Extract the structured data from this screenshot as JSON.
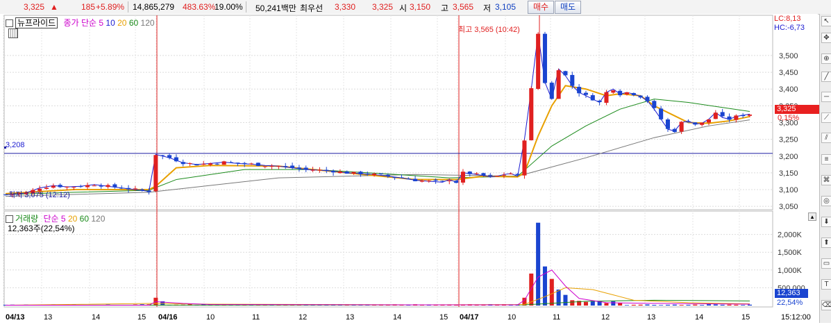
{
  "quote": {
    "price": "3,325",
    "arrow": "▲",
    "change": "185",
    "change_pct": "+5.89%",
    "volume": "14,865,279",
    "volume_ratio": "483.63%",
    "turnover": "19.00%",
    "amount": "50,241백만",
    "best_label": "최우선",
    "ask": "3,330",
    "bid": "3,325",
    "open_label": "시",
    "open": "3,150",
    "high_label": "고",
    "high": "3,565",
    "low_label": "저",
    "low": "3,105",
    "buy_button": "매수",
    "sell_button": "매도"
  },
  "price_legend": {
    "series_box": "뉴프라이드",
    "ma_label": "종가 단순",
    "ma5": "5",
    "ma10": "10",
    "ma20": "20",
    "ma60": "60",
    "ma120": "120"
  },
  "volume_legend": {
    "title": "거래량",
    "ma_label": "단순",
    "ma5": "5",
    "ma20": "20",
    "ma60": "60",
    "ma120": "120",
    "current": "12,363주(22,54%)"
  },
  "annotations": {
    "high_mark": "최고 3,565 (10:42)",
    "low_mark": "최저 3,075 (12:12)",
    "ref_price": "3,208",
    "lc": "LC:8,13",
    "hc": "HC:-6,73",
    "price_badge": "3,325",
    "price_badge_pct": "0,15%",
    "vol_badge": "12,363",
    "vol_badge_pct": "22,54%"
  },
  "colors": {
    "up": "#e02020",
    "down": "#1a44d0",
    "ma5": "#cc00cc",
    "ma10": "#1a1ad0",
    "ma20": "#e8a000",
    "ma60": "#1a8a1a",
    "ma120": "#777777"
  },
  "chart_data": {
    "type": "candlestick",
    "price_axis": {
      "range": [
        3040,
        3620
      ],
      "ticks": [
        "3,050",
        "3,100",
        "3,150",
        "3,200",
        "3,250",
        "3,300",
        "3,350",
        "3,400",
        "3,450",
        "3,500"
      ]
    },
    "volume_axis": {
      "range": [
        0,
        2500000
      ],
      "ticks": [
        "500,000",
        "1,000K",
        "1,500K",
        "2,000K"
      ]
    },
    "time_axis": [
      "04/13",
      "13",
      "14",
      "15",
      "04/16",
      "10",
      "11",
      "12",
      "13",
      "14",
      "15",
      "04/17",
      "10",
      "11",
      "12",
      "13",
      "14",
      "15",
      "15:12:00"
    ],
    "reference_line": 3208,
    "price_path": [
      [
        0,
        3085
      ],
      [
        3,
        3090
      ],
      [
        5,
        3105
      ],
      [
        7,
        3112
      ],
      [
        9,
        3108
      ],
      [
        11,
        3110
      ],
      [
        13,
        3115
      ],
      [
        15,
        3110
      ],
      [
        17,
        3105
      ],
      [
        19,
        3100
      ],
      [
        21,
        3095
      ],
      [
        22,
        3205
      ],
      [
        24,
        3195
      ],
      [
        26,
        3180
      ],
      [
        28,
        3175
      ],
      [
        30,
        3178
      ],
      [
        32,
        3182
      ],
      [
        34,
        3178
      ],
      [
        36,
        3176
      ],
      [
        38,
        3172
      ],
      [
        40,
        3170
      ],
      [
        42,
        3165
      ],
      [
        44,
        3160
      ],
      [
        46,
        3158
      ],
      [
        48,
        3155
      ],
      [
        50,
        3150
      ],
      [
        52,
        3148
      ],
      [
        54,
        3145
      ],
      [
        56,
        3140
      ],
      [
        58,
        3135
      ],
      [
        60,
        3128
      ],
      [
        62,
        3125
      ],
      [
        64,
        3122
      ],
      [
        65,
        3130
      ],
      [
        66,
        3122
      ],
      [
        67,
        3150
      ],
      [
        68,
        3148
      ],
      [
        69,
        3145
      ],
      [
        70,
        3142
      ],
      [
        71,
        3138
      ],
      [
        72,
        3140
      ],
      [
        73,
        3145
      ],
      [
        74,
        3148
      ],
      [
        75,
        3140
      ],
      [
        76,
        3250
      ],
      [
        77,
        3400
      ],
      [
        78,
        3565
      ],
      [
        79,
        3420
      ],
      [
        80,
        3370
      ],
      [
        81,
        3460
      ],
      [
        82,
        3440
      ],
      [
        83,
        3410
      ],
      [
        84,
        3390
      ],
      [
        85,
        3380
      ],
      [
        86,
        3370
      ],
      [
        87,
        3360
      ],
      [
        88,
        3390
      ],
      [
        89,
        3400
      ],
      [
        90,
        3385
      ],
      [
        91,
        3390
      ],
      [
        92,
        3385
      ],
      [
        93,
        3378
      ],
      [
        94,
        3365
      ],
      [
        95,
        3340
      ],
      [
        96,
        3310
      ],
      [
        97,
        3280
      ],
      [
        98,
        3275
      ],
      [
        99,
        3300
      ],
      [
        100,
        3305
      ],
      [
        101,
        3295
      ],
      [
        102,
        3298
      ],
      [
        103,
        3310
      ],
      [
        104,
        3330
      ],
      [
        105,
        3315
      ],
      [
        106,
        3310
      ],
      [
        107,
        3318
      ],
      [
        108,
        3322
      ],
      [
        109,
        3325
      ]
    ],
    "ma_price": {
      "ma20": [
        [
          0,
          3088
        ],
        [
          10,
          3100
        ],
        [
          21,
          3100
        ],
        [
          22,
          3110
        ],
        [
          25,
          3165
        ],
        [
          30,
          3172
        ],
        [
          40,
          3170
        ],
        [
          50,
          3150
        ],
        [
          60,
          3130
        ],
        [
          66,
          3130
        ],
        [
          70,
          3140
        ],
        [
          75,
          3138
        ],
        [
          76,
          3150
        ],
        [
          78,
          3260
        ],
        [
          80,
          3350
        ],
        [
          82,
          3410
        ],
        [
          85,
          3400
        ],
        [
          88,
          3380
        ],
        [
          90,
          3386
        ],
        [
          93,
          3380
        ],
        [
          95,
          3350
        ],
        [
          98,
          3320
        ],
        [
          100,
          3300
        ],
        [
          103,
          3298
        ],
        [
          106,
          3305
        ],
        [
          109,
          3318
        ]
      ],
      "ma60": [
        [
          0,
          3085
        ],
        [
          10,
          3092
        ],
        [
          21,
          3098
        ],
        [
          25,
          3130
        ],
        [
          35,
          3160
        ],
        [
          45,
          3160
        ],
        [
          55,
          3148
        ],
        [
          65,
          3135
        ],
        [
          75,
          3140
        ],
        [
          80,
          3230
        ],
        [
          85,
          3290
        ],
        [
          90,
          3340
        ],
        [
          95,
          3370
        ],
        [
          100,
          3360
        ],
        [
          105,
          3345
        ],
        [
          109,
          3333
        ]
      ],
      "ma120": [
        [
          0,
          3080
        ],
        [
          21,
          3092
        ],
        [
          40,
          3135
        ],
        [
          60,
          3145
        ],
        [
          75,
          3140
        ],
        [
          85,
          3195
        ],
        [
          95,
          3255
        ],
        [
          103,
          3290
        ],
        [
          109,
          3308
        ]
      ]
    },
    "volume_highlights": [
      [
        76,
        220000
      ],
      [
        77,
        900000
      ],
      [
        78,
        2330000
      ],
      [
        79,
        1100000
      ],
      [
        80,
        750000
      ],
      [
        81,
        450000
      ],
      [
        82,
        300000
      ],
      [
        83,
        150000
      ],
      [
        22,
        220000
      ],
      [
        23,
        120000
      ]
    ],
    "ma_volume": {
      "ma5": [
        [
          0,
          10000
        ],
        [
          21,
          10000
        ],
        [
          22,
          110000
        ],
        [
          26,
          60000
        ],
        [
          30,
          30000
        ],
        [
          60,
          20000
        ],
        [
          75,
          20000
        ],
        [
          76,
          150000
        ],
        [
          78,
          800000
        ],
        [
          80,
          1000000
        ],
        [
          82,
          550000
        ],
        [
          84,
          200000
        ],
        [
          88,
          80000
        ],
        [
          95,
          60000
        ],
        [
          109,
          40000
        ]
      ],
      "ma20": [
        [
          0,
          10000
        ],
        [
          22,
          60000
        ],
        [
          30,
          40000
        ],
        [
          60,
          20000
        ],
        [
          76,
          30000
        ],
        [
          79,
          250000
        ],
        [
          82,
          500000
        ],
        [
          86,
          450000
        ],
        [
          89,
          300000
        ],
        [
          92,
          150000
        ],
        [
          100,
          80000
        ],
        [
          109,
          50000
        ]
      ],
      "ma60": [
        [
          0,
          10000
        ],
        [
          76,
          20000
        ],
        [
          85,
          120000
        ],
        [
          95,
          150000
        ],
        [
          109,
          130000
        ]
      ]
    }
  }
}
